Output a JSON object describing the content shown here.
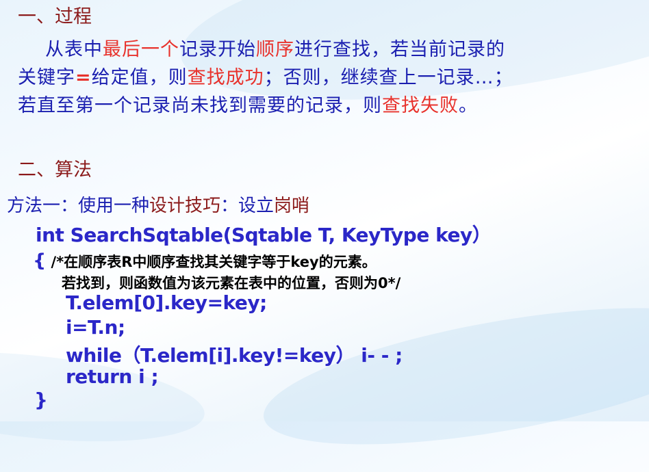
{
  "section1": {
    "heading": "一、过程",
    "line1": [
      "从表中",
      "最后一个",
      "记录开始",
      "顺序",
      "进行查找，若当前记录的"
    ],
    "line2": [
      "关键字",
      "=",
      "给定值，则",
      "查找成功",
      "；否则，继续查上一记录…；"
    ],
    "line3": [
      "若直至第一个记录尚未找到需要的记录，则",
      "查找失败",
      "。"
    ]
  },
  "section2": {
    "heading": "二、算法",
    "method_line": [
      "方法一：使用一种",
      "设计技巧",
      "：设立",
      "岗哨"
    ]
  },
  "code": {
    "signature": "int  SearchSqtable(Sqtable T, KeyType key）",
    "open_brace": "{",
    "comment1": " /*在顺序表R中顺序查找其关键字等于key的元素。",
    "comment2": "若找到，则函数值为该元素在表中的位置，否则为0*/",
    "stmt1": "T.elem[0].key=key;",
    "stmt2": "i=T.n;",
    "stmt3": "while（T.elem[i].key!=key） i- - ;",
    "stmt4": "return i ;",
    "close_brace": "}"
  }
}
